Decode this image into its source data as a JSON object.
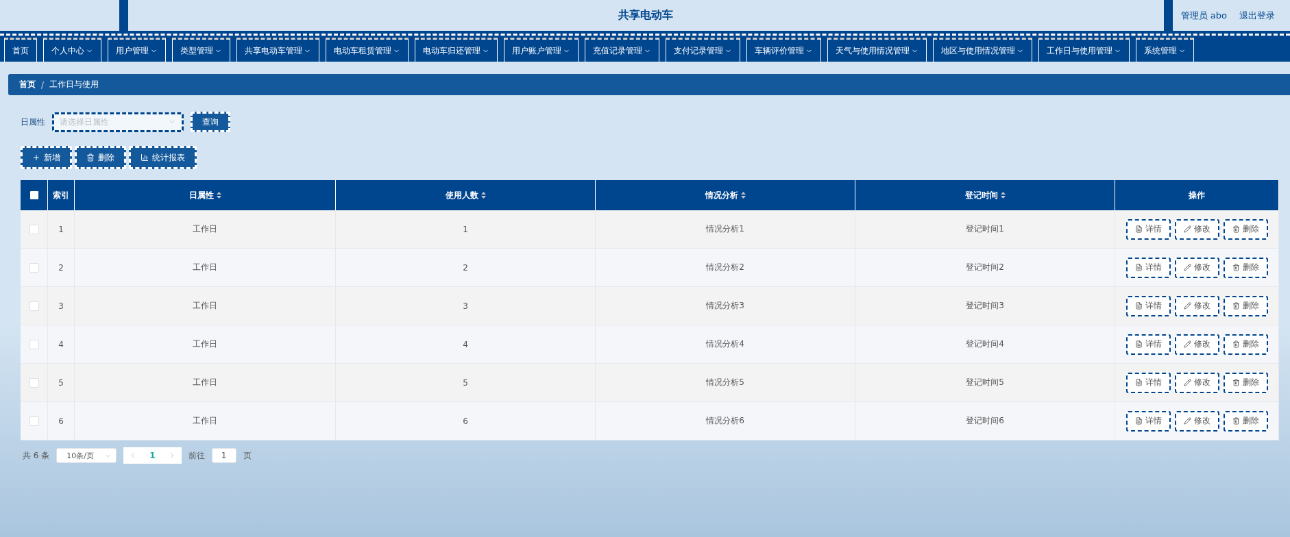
{
  "header": {
    "title": "共享电动车",
    "user": "管理员 abo",
    "logout": "退出登录"
  },
  "nav": [
    {
      "label": "首页",
      "dropdown": false
    },
    {
      "label": "个人中心",
      "dropdown": true
    },
    {
      "label": "用户管理",
      "dropdown": true
    },
    {
      "label": "类型管理",
      "dropdown": true
    },
    {
      "label": "共享电动车管理",
      "dropdown": true
    },
    {
      "label": "电动车租赁管理",
      "dropdown": true
    },
    {
      "label": "电动车归还管理",
      "dropdown": true
    },
    {
      "label": "用户账户管理",
      "dropdown": true
    },
    {
      "label": "充值记录管理",
      "dropdown": true
    },
    {
      "label": "支付记录管理",
      "dropdown": true
    },
    {
      "label": "车辆评价管理",
      "dropdown": true
    },
    {
      "label": "天气与使用情况管理",
      "dropdown": true
    },
    {
      "label": "地区与使用情况管理",
      "dropdown": true
    },
    {
      "label": "工作日与使用管理",
      "dropdown": true
    },
    {
      "label": "系统管理",
      "dropdown": true
    }
  ],
  "breadcrumb": {
    "items": [
      "首页",
      "工作日与使用"
    ],
    "separator": "/"
  },
  "filter": {
    "label": "日属性",
    "placeholder": "请选择日属性",
    "button": "查询"
  },
  "actions": [
    {
      "kind": "add",
      "label": "新增"
    },
    {
      "kind": "delete",
      "label": "删除"
    },
    {
      "kind": "chart",
      "label": "统计报表"
    }
  ],
  "table": {
    "select_all": {
      "checked": false
    },
    "columns": [
      {
        "label": "索引",
        "sortable": false
      },
      {
        "label": "日属性",
        "sortable": true
      },
      {
        "label": "使用人数",
        "sortable": true
      },
      {
        "label": "情况分析",
        "sortable": true
      },
      {
        "label": "登记时间",
        "sortable": true
      },
      {
        "label": "操作",
        "sortable": false
      }
    ],
    "rows": [
      {
        "checked": false,
        "cells": [
          "1",
          "工作日",
          "1",
          "情况分析1",
          "登记时间1"
        ],
        "actions": [
          "详情",
          "修改",
          "删除"
        ]
      },
      {
        "checked": false,
        "cells": [
          "2",
          "工作日",
          "2",
          "情况分析2",
          "登记时间2"
        ],
        "actions": [
          "详情",
          "修改",
          "删除"
        ]
      },
      {
        "checked": false,
        "cells": [
          "3",
          "工作日",
          "3",
          "情况分析3",
          "登记时间3"
        ],
        "actions": [
          "详情",
          "修改",
          "删除"
        ]
      },
      {
        "checked": false,
        "cells": [
          "4",
          "工作日",
          "4",
          "情况分析4",
          "登记时间4"
        ],
        "actions": [
          "详情",
          "修改",
          "删除"
        ]
      },
      {
        "checked": false,
        "cells": [
          "5",
          "工作日",
          "5",
          "情况分析5",
          "登记时间5"
        ],
        "actions": [
          "详情",
          "修改",
          "删除"
        ]
      },
      {
        "checked": false,
        "cells": [
          "6",
          "工作日",
          "6",
          "情况分析6",
          "登记时间6"
        ],
        "actions": [
          "详情",
          "修改",
          "删除"
        ]
      }
    ]
  },
  "pagination": {
    "total": "共 6 条",
    "page_size": "10条/页",
    "pages": [
      {
        "label": "1",
        "selected": true
      }
    ],
    "goto_label": "前往",
    "goto_value": "1",
    "page_suffix": "页"
  }
}
